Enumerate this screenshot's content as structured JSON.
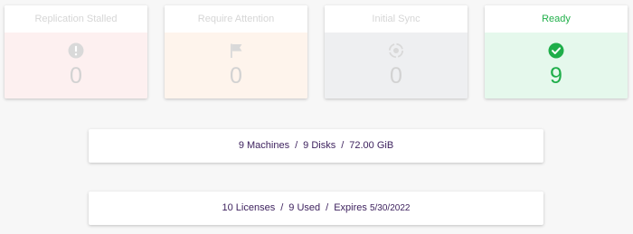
{
  "cards": [
    {
      "title": "Replication Stalled",
      "count": "0",
      "icon": "exclamation-circle-icon"
    },
    {
      "title": "Require Attention",
      "count": "0",
      "icon": "flag-icon"
    },
    {
      "title": "Initial Sync",
      "count": "0",
      "icon": "sync-circle-icon"
    },
    {
      "title": "Ready",
      "count": "9",
      "icon": "check-circle-icon"
    }
  ],
  "colors": {
    "ready_accent": "#22b04b",
    "stalled_bg": "#fdf0f0",
    "attention_bg": "#fef4ec",
    "sync_bg": "#eeeff1",
    "ready_bg": "#e5f8ec",
    "summary_text": "#3b1f5c"
  },
  "summary": {
    "machines": "9 Machines",
    "disks": "9 Disks",
    "size": "72.00 GiB",
    "separator": "/"
  },
  "licenses": {
    "total": "10 Licenses",
    "used": "9 Used",
    "expires_label": "Expires",
    "expires_date": "5/30/2022",
    "separator": "/"
  }
}
